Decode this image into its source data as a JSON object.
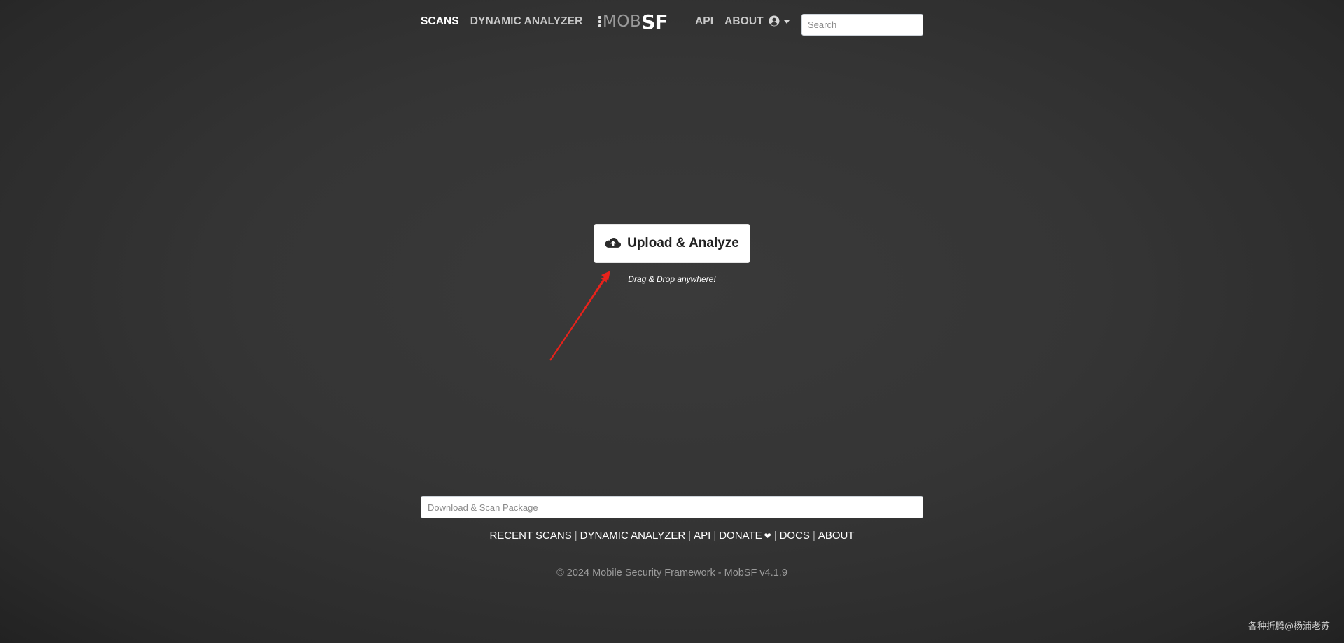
{
  "nav": {
    "scans": "SCANS",
    "dynamic_analyzer": "DYNAMIC ANALYZER",
    "brand_mob": "MOB",
    "brand_sf": "SF",
    "api": "API",
    "about": "ABOUT",
    "search_placeholder": "Search"
  },
  "upload": {
    "button_label": "Upload & Analyze",
    "icon": "cloud-upload-icon",
    "hint": "Drag & Drop anywhere!"
  },
  "package_input": {
    "placeholder": "Download & Scan Package"
  },
  "footer": {
    "links": [
      "RECENT SCANS",
      "DYNAMIC ANALYZER",
      "API",
      "DONATE",
      "DOCS",
      "ABOUT"
    ],
    "donate_icon": "heart-icon",
    "copyright": "© 2024 Mobile Security Framework - MobSF v4.1.9"
  },
  "watermark": "各种折腾@杨浦老苏",
  "colors": {
    "background": "#353535",
    "annotation_arrow": "#e8221b",
    "nav_active": "#ffffff",
    "nav_inactive": "#c9c9c9"
  }
}
